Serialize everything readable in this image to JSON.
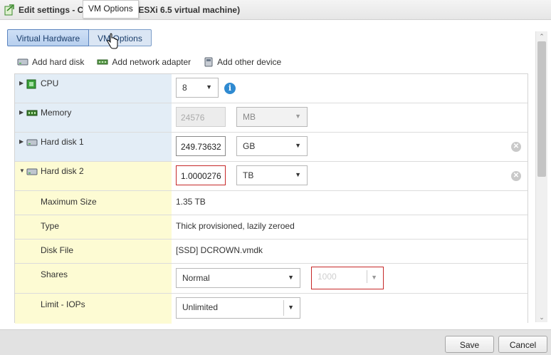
{
  "dialog": {
    "title": "Edit settings - C",
    "title_suffix": "ESXi 6.5 virtual machine)",
    "tooltip": "VM Options"
  },
  "tabs": [
    {
      "label": "Virtual Hardware",
      "active": true
    },
    {
      "label": "VM Options",
      "active": false
    }
  ],
  "toolbar": {
    "add_hard_disk": "Add hard disk",
    "add_network_adapter": "Add network adapter",
    "add_other_device": "Add other device"
  },
  "hardware": {
    "cpu": {
      "label": "CPU",
      "value": "8"
    },
    "memory": {
      "label": "Memory",
      "value": "24576",
      "unit": "MB"
    },
    "hard_disk_1": {
      "label": "Hard disk 1",
      "value": "249.73632",
      "unit": "GB"
    },
    "hard_disk_2": {
      "label": "Hard disk 2",
      "value": "1.0000276",
      "unit": "TB",
      "maximum_size_label": "Maximum Size",
      "maximum_size": "1.35 TB",
      "type_label": "Type",
      "type": "Thick provisioned, lazily zeroed",
      "disk_file_label": "Disk File",
      "disk_file": "[SSD] DCROWN.vmdk",
      "shares_label": "Shares",
      "shares": "Normal",
      "shares_value": "1000",
      "limit_label": "Limit - IOPs",
      "limit": "Unlimited"
    }
  },
  "footer": {
    "save": "Save",
    "cancel": "Cancel"
  },
  "colors": {
    "accent": "#2f8ad1",
    "error": "#c62828",
    "label_blue": "#e3edf6",
    "label_yellow": "#fdfbd3"
  }
}
